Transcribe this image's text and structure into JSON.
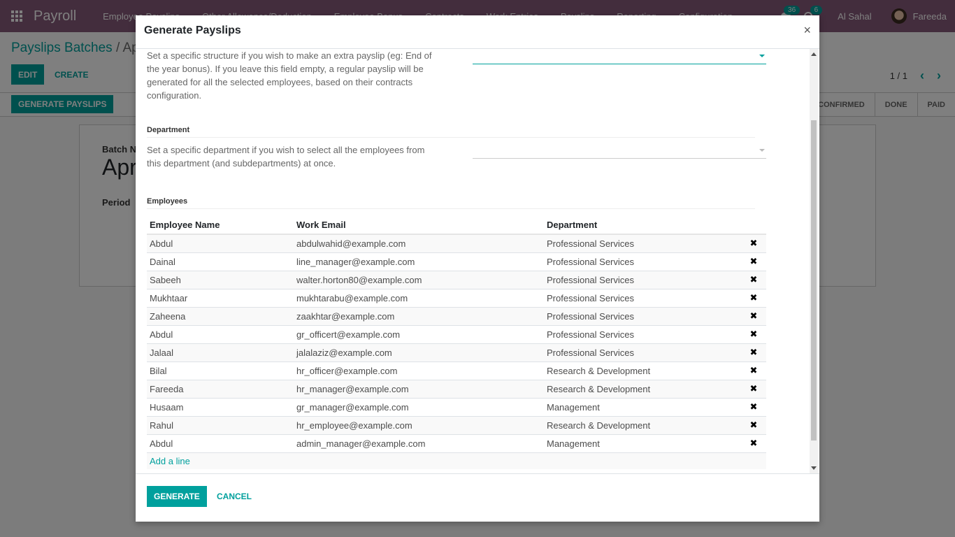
{
  "navbar": {
    "app_name": "Payroll",
    "menu": [
      "Employee Payslips",
      "Other Allowance/Deduction",
      "Employee Bonus",
      "Contracts",
      "Work Entries",
      "Payslips",
      "Reporting",
      "Configuration"
    ],
    "messages_badge": "36",
    "activities_badge": "6",
    "company": "Al Sahal",
    "user": "Fareeda"
  },
  "control_panel": {
    "breadcrumb_parent": "Payslips Batches",
    "breadcrumb_sep": " / ",
    "breadcrumb_current": "April",
    "edit_label": "EDIT",
    "create_label": "CREATE",
    "pager": "1 / 1",
    "generate_payslips_label": "GENERATE PAYSLIPS",
    "stages": [
      "CONFIRMED",
      "DONE",
      "PAID"
    ]
  },
  "sheet": {
    "batch_name_label": "Batch Name",
    "batch_name": "April",
    "period_label": "Period"
  },
  "modal": {
    "title": "Generate Payslips",
    "close_glyph": "×",
    "structure_help": "Set a specific structure if you wish to make an extra payslip (eg: End of the year bonus). If you leave this field empty, a regular payslip will be generated for all the selected employees, based on their contracts configuration.",
    "structure_value": "",
    "department_label": "Department",
    "department_help": "Set a specific department if you wish to select all the employees from this department (and subdepartments) at once.",
    "department_value": "",
    "employees_label": "Employees",
    "columns": [
      "Employee Name",
      "Work Email",
      "Department"
    ],
    "rows": [
      {
        "name": "Abdul",
        "email": "abdulwahid@example.com",
        "department": "Professional Services"
      },
      {
        "name": "Dainal",
        "email": "line_manager@example.com",
        "department": "Professional Services"
      },
      {
        "name": "Sabeeh",
        "email": "walter.horton80@example.com",
        "department": "Professional Services"
      },
      {
        "name": "Mukhtaar",
        "email": "mukhtarabu@example.com",
        "department": "Professional Services"
      },
      {
        "name": "Zaheena",
        "email": "zaakhtar@example.com",
        "department": "Professional Services"
      },
      {
        "name": "Abdul",
        "email": "gr_officert@example.com",
        "department": "Professional Services"
      },
      {
        "name": "Jalaal",
        "email": "jalalaziz@example.com",
        "department": "Professional Services"
      },
      {
        "name": "Bilal",
        "email": "hr_officer@example.com",
        "department": "Research & Development"
      },
      {
        "name": "Fareeda",
        "email": "hr_manager@example.com",
        "department": "Research & Development"
      },
      {
        "name": "Husaam",
        "email": "gr_manager@example.com",
        "department": "Management"
      },
      {
        "name": "Rahul",
        "email": "hr_employee@example.com",
        "department": "Research & Development"
      },
      {
        "name": "Abdul",
        "email": "admin_manager@example.com",
        "department": "Management"
      }
    ],
    "delete_glyph": "✖",
    "add_line_label": "Add a line",
    "generate_label": "GENERATE",
    "cancel_label": "CANCEL"
  },
  "colors": {
    "brand": "#875a7b",
    "accent": "#00a09d"
  }
}
